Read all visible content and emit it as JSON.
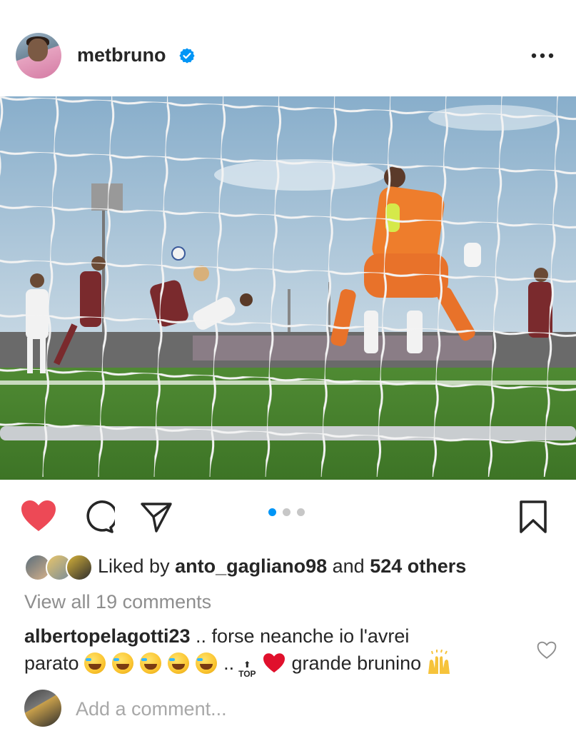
{
  "post": {
    "username": "metbruno",
    "verified": true,
    "more_icon": "more-horizontal-icon"
  },
  "actions": {
    "liked": true,
    "carousel_count": 3,
    "carousel_active": 1
  },
  "likes": {
    "prefix": "Liked by ",
    "user": "anto_gagliano98",
    "middle": " and ",
    "others": "524 others"
  },
  "comments": {
    "view_all": "View all 19 comments",
    "items": [
      {
        "user": "albertopelagotti23",
        "line1": " .. forse neanche io l'avrei",
        "line2_prefix": "parato ",
        "line2_dots": "..",
        "top_label": "TOP",
        "line2_suffix": "grande brunino"
      }
    ]
  },
  "composer": {
    "placeholder": "Add a comment..."
  },
  "colors": {
    "like": "#ed4956",
    "accent": "#0095f6",
    "verified": "#0095f6",
    "muted": "#8e8e8e"
  }
}
